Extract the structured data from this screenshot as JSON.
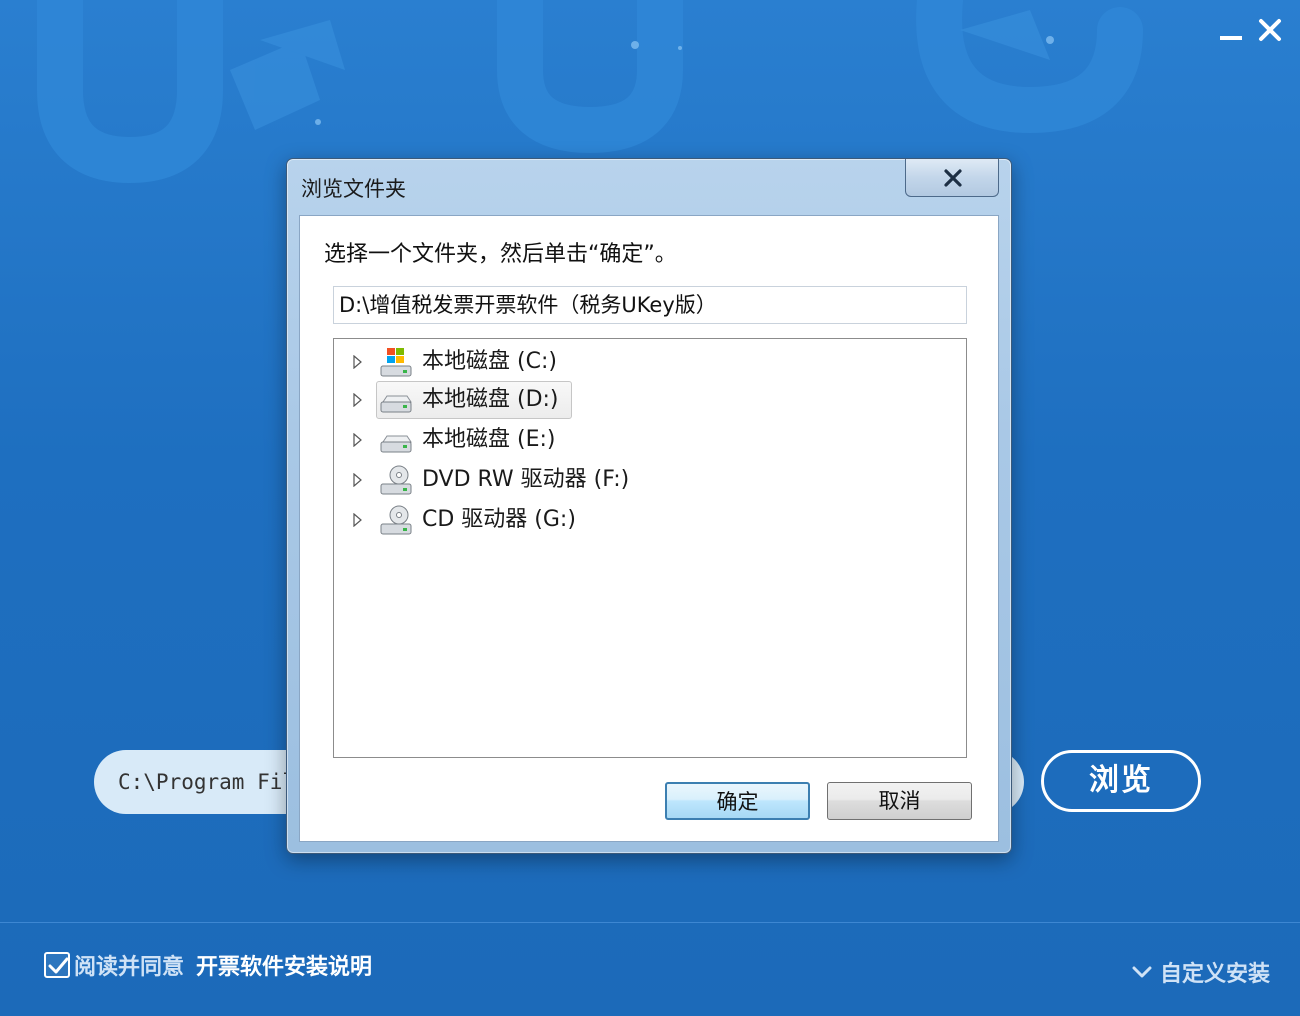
{
  "installer": {
    "path_value": "C:\\Program Fil",
    "browse_label": "浏览",
    "agree_text": "阅读并同意",
    "agree_link": "开票软件安装说明",
    "agree_checked": true,
    "custom_install_label": "自定义安装",
    "minimize_icon": "minimize-icon",
    "close_icon": "close-icon"
  },
  "dialog": {
    "title": "浏览文件夹",
    "instruction": "选择一个文件夹，然后单击“确定”。",
    "path_value": "D:\\增值税发票开票软件（税务UKey版）",
    "tree_items": [
      {
        "label": "本地磁盘 (C:)",
        "icon": "system-drive-icon",
        "selected": false
      },
      {
        "label": "本地磁盘 (D:)",
        "icon": "hard-drive-icon",
        "selected": true
      },
      {
        "label": "本地磁盘 (E:)",
        "icon": "hard-drive-icon",
        "selected": false
      },
      {
        "label": "DVD RW 驱动器 (F:)",
        "icon": "optical-drive-icon",
        "selected": false
      },
      {
        "label": "CD 驱动器 (G:)",
        "icon": "optical-drive-icon",
        "selected": false
      }
    ],
    "ok_label": "确定",
    "cancel_label": "取消"
  },
  "colors": {
    "background": "#1f72c4",
    "accent": "#ffffff",
    "dialog_frame": "#a9c8e6"
  }
}
